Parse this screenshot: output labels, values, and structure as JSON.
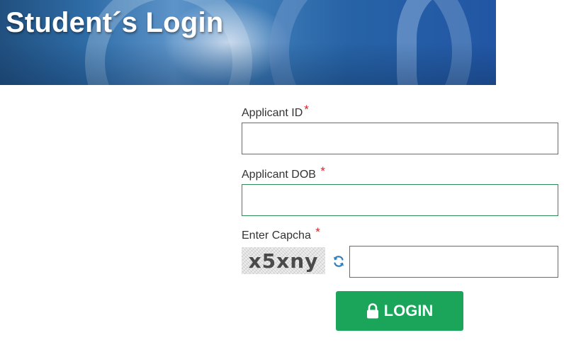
{
  "header": {
    "title": "Student´s Login"
  },
  "form": {
    "applicant_id_label": "Applicant ID",
    "applicant_dob_label": "Applicant DOB",
    "captcha_label": "Enter Capcha",
    "required_mark": "*",
    "applicant_id_value": "",
    "applicant_dob_value": "",
    "captcha_value": "",
    "captcha_text": "x5xny",
    "login_label": "LOGIN"
  },
  "icons": {
    "refresh": "refresh-icon",
    "lock": "lock-icon"
  },
  "colors": {
    "input_border": "#2e8b57",
    "required": "#d9232d",
    "login_button": "#1aa55a",
    "refresh_icon": "#2d7fc1"
  }
}
